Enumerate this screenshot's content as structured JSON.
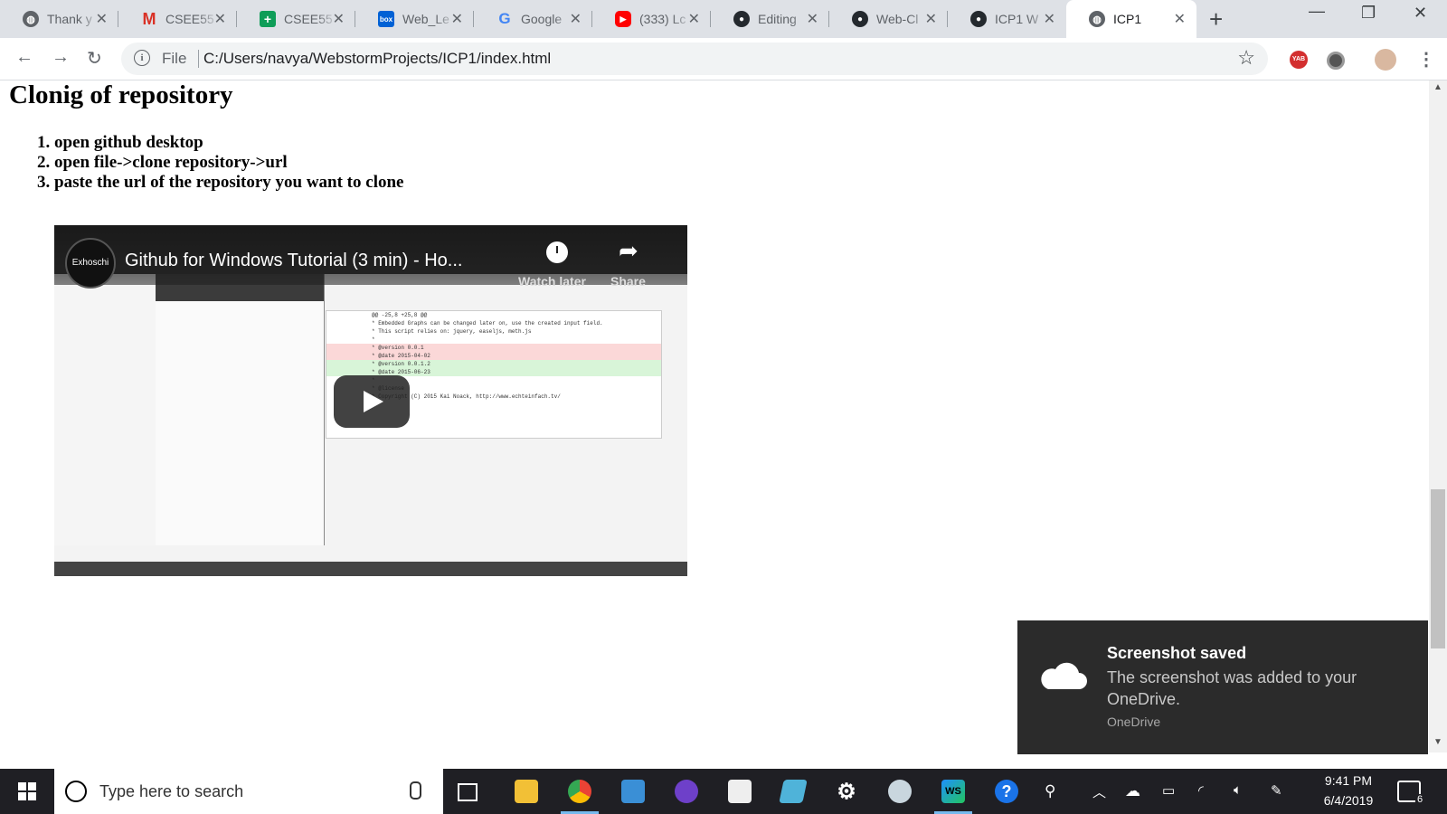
{
  "browser": {
    "tabs": [
      {
        "title": "Thank y",
        "icon": "globe-icon",
        "active": false
      },
      {
        "title": "CSEE55",
        "icon": "gmail-icon",
        "active": false
      },
      {
        "title": "CSEE55",
        "icon": "sheets-icon",
        "active": false
      },
      {
        "title": "Web_Le",
        "icon": "box-icon",
        "active": false
      },
      {
        "title": "Google",
        "icon": "google-icon",
        "active": false
      },
      {
        "title": "(333) Lc",
        "icon": "youtube-icon",
        "active": false
      },
      {
        "title": "Editing",
        "icon": "github-icon",
        "active": false
      },
      {
        "title": "Web-Cl",
        "icon": "github-icon",
        "active": false
      },
      {
        "title": "ICP1 W",
        "icon": "github-icon",
        "active": false
      },
      {
        "title": "ICP1",
        "icon": "globe-icon",
        "active": true
      }
    ],
    "address": {
      "scheme": "File",
      "url": "C:/Users/navya/WebstormProjects/ICP1/index.html"
    },
    "extension_label": "YAB"
  },
  "page": {
    "heading": "Clonig of repository",
    "steps": [
      "open github desktop",
      "open file->clone repository->url",
      "paste the url of the repository you want to clone"
    ],
    "video": {
      "title": "Github for Windows Tutorial (3 min) - Ho...",
      "channel": "Exhoschi",
      "watch_later": "Watch later",
      "share": "Share",
      "diff_lines": [
        "@@ -25,8 +25,8 @@",
        "* Embedded Graphs can be changed later on, use the created input field.",
        "* This script relies on: jquery, easeljs, meth.js",
        "*",
        "* @version 0.0.1",
        "* @date    2015-04-02",
        "* @version 0.0.1.2",
        "* @date    2015-06-23",
        "*",
        "* @license",
        "* Copyright (C) 2015 Kai Noack, http://www.echteinfach.tv/"
      ]
    }
  },
  "toast": {
    "title": "Screenshot saved",
    "body": "The screenshot was added to your OneDrive.",
    "source": "OneDrive"
  },
  "taskbar": {
    "search_placeholder": "Type here to search",
    "time": "9:41 PM",
    "date": "6/4/2019",
    "notification_count": "6",
    "ws_label": "WS"
  }
}
